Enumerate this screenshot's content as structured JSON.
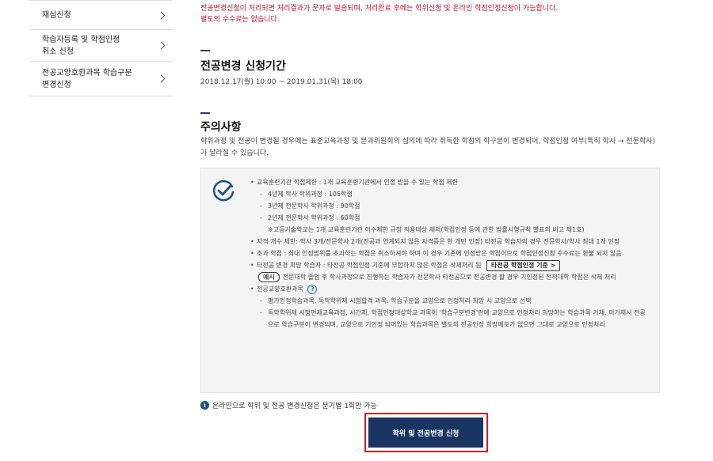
{
  "sidebar": {
    "items": [
      {
        "label": "재심신청"
      },
      {
        "label": "학습자등록 및 학점인정\n취소 신청"
      },
      {
        "label": "전공교양호환과목 학습구분\n변경신청"
      }
    ]
  },
  "notice": {
    "text": "전공변경신청이 처리되면 처리결과가 문자로 발송되며, 처리완료 후에는 학위신청 및 온라인 학점인정신청이 가능합니다.\n별도의 수수료는 없습니다."
  },
  "period_section": {
    "title": "전공변경 신청기간",
    "period": "2018.12.17(월) 10:00 ~ 2019.01.31(목) 18:00"
  },
  "caution": {
    "title": "주의사항",
    "description": "학위과정 및 전공이 변경될 경우에는 표준교육과정 및 분과위원회의 심의에 따라 취득한 학점의 학구분이 변경되어, 학점인정 여부(특히 학사 → 전문학사)가 달라질 수 있습니다."
  },
  "rules": {
    "bullet": "•",
    "dash": "-",
    "r1": "교육훈련기관 학점제한 : 1개 교육훈련기관에서 인정 받을 수 있는 학점 제한",
    "r1_sub1": "4년제 학사 학위과정 : 105학점",
    "r1_sub2": "3년제 전문학사 학위과정 : 90학점",
    "r1_sub3": "2년제 전문학사 학위과정 : 60학점",
    "r1_note": "※고등기술학교는 1개 교육훈련기관 이수제한 규정 적용대상 제외(학점인정 등에 관한 법률시행규칙 별표의 비고 제1호)",
    "r2": "자격 개수 제한: 학사 3개/전문학사 2개(전공과 연계되지 않은 자격증은 한 개만 인정) 타전공 학습자의 경우 전문학사/학사 최대 1개 인정",
    "r3": "초과 학점 : 최대 인정범위를 초과하는 학점은 취소하셔야 하며 이 경우 기존에 인정받은 학점이므로 학점인정신청 수수료는 환불 되지 않음",
    "r4": "타전공 변경 희망 학습자 : 타전공 학점인정 기준에 부합하지 않은 학점은 삭제처리 됨",
    "r4_button": "타전공 학점인정 기준 >",
    "example_label": "예시",
    "example_text": "전문대학 졸업 후 학사과정으로 진행하는 학습자가 전문학사 타전공으로 전공변경 할 경우 기인정된 전적대학 학점은 삭제 처리",
    "r5": "전공교양호환과목",
    "r5_help": "?",
    "r5_sub1": "평가인정학습과목, 독학학위제 시험합격 과목: 학습구분을 교양으로 인정처리 희망 시 교양으로 선택",
    "r5_sub2": "독학학위제 시험면제교육과정, 시간제, 학점인정대상학교 과목이 '학습구분변경'란에 교양으로 인정처리 희망하는 학습과목 기재. 미기재시 전공으로 학습구분이 변경되며, 교양으로 기인정 되어있는 학습과목은 별도의 전공인정 희망메모가 없으면 그대로 교양으로 인정처리"
  },
  "bottom": {
    "info_glyph": "i",
    "info_text": "온라인으로 학위 및 전공 변경신청은 분기별 1회만 가능",
    "apply_button": "학위 및 전공변경 신청"
  },
  "colors": {
    "accent": "#1b3563",
    "notice_red": "#c8102e",
    "highlight": "#d21f1f"
  }
}
